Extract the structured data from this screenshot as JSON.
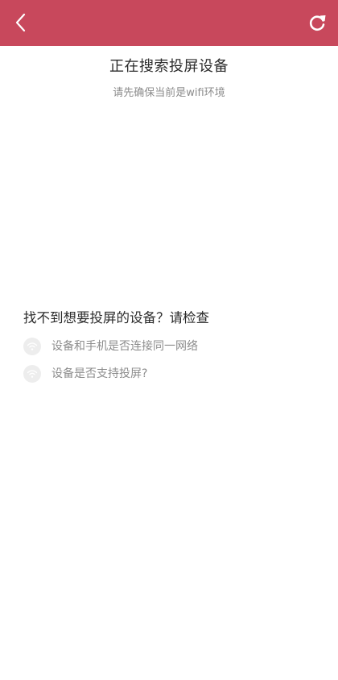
{
  "header": {
    "back_icon": "chevron-left-icon",
    "refresh_icon": "refresh-icon",
    "bar_color": "#c8485c"
  },
  "main": {
    "title": "正在搜索投屏设备",
    "subtitle": "请先确保当前是wifi环境"
  },
  "help": {
    "heading": "找不到想要投屏的设备？请检查",
    "tips": [
      {
        "icon": "wifi-icon",
        "text": "设备和手机是否连接同一网络"
      },
      {
        "icon": "wifi-icon",
        "text": "设备是否支持投屏?"
      }
    ]
  }
}
